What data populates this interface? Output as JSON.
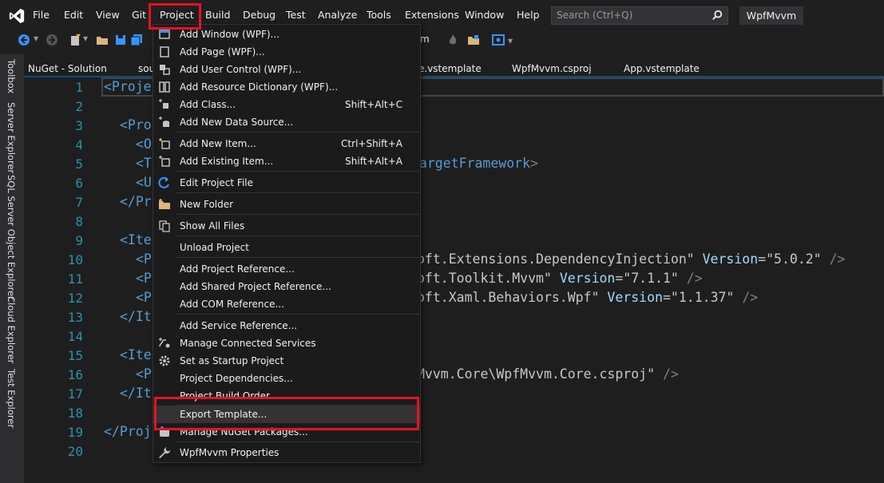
{
  "menubar": {
    "items": [
      "File",
      "Edit",
      "View",
      "Git",
      "Project",
      "Build",
      "Debug",
      "Test",
      "Analyze",
      "Tools",
      "Extensions",
      "Window",
      "Help"
    ],
    "search_placeholder": "Search (Ctrl+Q)",
    "project_title": "WpfMvvm"
  },
  "toolbar": {
    "config_fragment": "m"
  },
  "tabs": [
    "NuGet - Solution",
    "sou",
    "e.vstemplate",
    "WpfMvvm.csproj",
    "App.vstemplate"
  ],
  "side_tabs": [
    "Toolbox",
    "Server Explorer",
    "SQL Server Object Explorer",
    "Cloud Explorer",
    "Test Explorer"
  ],
  "line_numbers": [
    "1",
    "2",
    "3",
    "4",
    "5",
    "6",
    "7",
    "8",
    "9",
    "10",
    "11",
    "12",
    "13",
    "14",
    "15",
    "16",
    "17",
    "18",
    "19",
    "20"
  ],
  "code": {
    "l1": "<Proje",
    "l3": "<Pro",
    "l4": "<O",
    "l5a": "<T",
    "l5b": "TargetFramework",
    "l6": "<U",
    "l7": "</Pr",
    "l9": "<Ite",
    "l10a": "<P",
    "l10b": "oft.Extensions.DependencyInjection\"",
    "l10c": "Version",
    "l10d": "=\"5.0.2\"",
    "l10e": "/>",
    "l11a": "<P",
    "l11b": "oft.Toolkit.Mvvm\"",
    "l11c": "Version",
    "l11d": "=\"7.1.1\"",
    "l11e": "/>",
    "l12a": "<P",
    "l12b": "oft.Xaml.Behaviors.Wpf\"",
    "l12c": "Version",
    "l12d": "=\"1.1.37\"",
    "l12e": "/>",
    "l13": "</It",
    "l15": "<Ite",
    "l16a": "<P",
    "l16b": "Mvvm.Core\\WpfMvvm.Core.csproj\"",
    "l16c": "/>",
    "l17": "</It",
    "l19": "</Proj"
  },
  "project_menu": {
    "items": [
      {
        "label": "Add Window (WPF)...",
        "shortcut": ""
      },
      {
        "label": "Add Page (WPF)...",
        "shortcut": ""
      },
      {
        "label": "Add User Control (WPF)...",
        "shortcut": ""
      },
      {
        "label": "Add Resource Dictionary (WPF)...",
        "shortcut": ""
      },
      {
        "label": "Add Class...",
        "shortcut": "Shift+Alt+C"
      },
      {
        "label": "Add New Data Source...",
        "shortcut": ""
      },
      {
        "label": "Add New Item...",
        "shortcut": "Ctrl+Shift+A"
      },
      {
        "label": "Add Existing Item...",
        "shortcut": "Shift+Alt+A"
      },
      {
        "label": "Edit Project File",
        "shortcut": ""
      },
      {
        "label": "New Folder",
        "shortcut": ""
      },
      {
        "label": "Show All Files",
        "shortcut": ""
      },
      {
        "label": "Unload Project",
        "shortcut": ""
      },
      {
        "label": "Add Project Reference...",
        "shortcut": ""
      },
      {
        "label": "Add Shared Project Reference...",
        "shortcut": ""
      },
      {
        "label": "Add COM Reference...",
        "shortcut": ""
      },
      {
        "label": "Add Service Reference...",
        "shortcut": ""
      },
      {
        "label": "Manage Connected Services",
        "shortcut": ""
      },
      {
        "label": "Set as Startup Project",
        "shortcut": ""
      },
      {
        "label": "Project Dependencies...",
        "shortcut": ""
      },
      {
        "label": "Project Build Order...",
        "shortcut": ""
      },
      {
        "label": "Export Template...",
        "shortcut": ""
      },
      {
        "label": "Manage NuGet Packages...",
        "shortcut": ""
      },
      {
        "label": "WpfMvvm Properties",
        "shortcut": ""
      }
    ]
  },
  "colors": {
    "accent_highlight": "#e81123",
    "line_number": "#2b91af",
    "xml_tag": "#569cd6",
    "xml_attribute": "#9cdcfe"
  }
}
